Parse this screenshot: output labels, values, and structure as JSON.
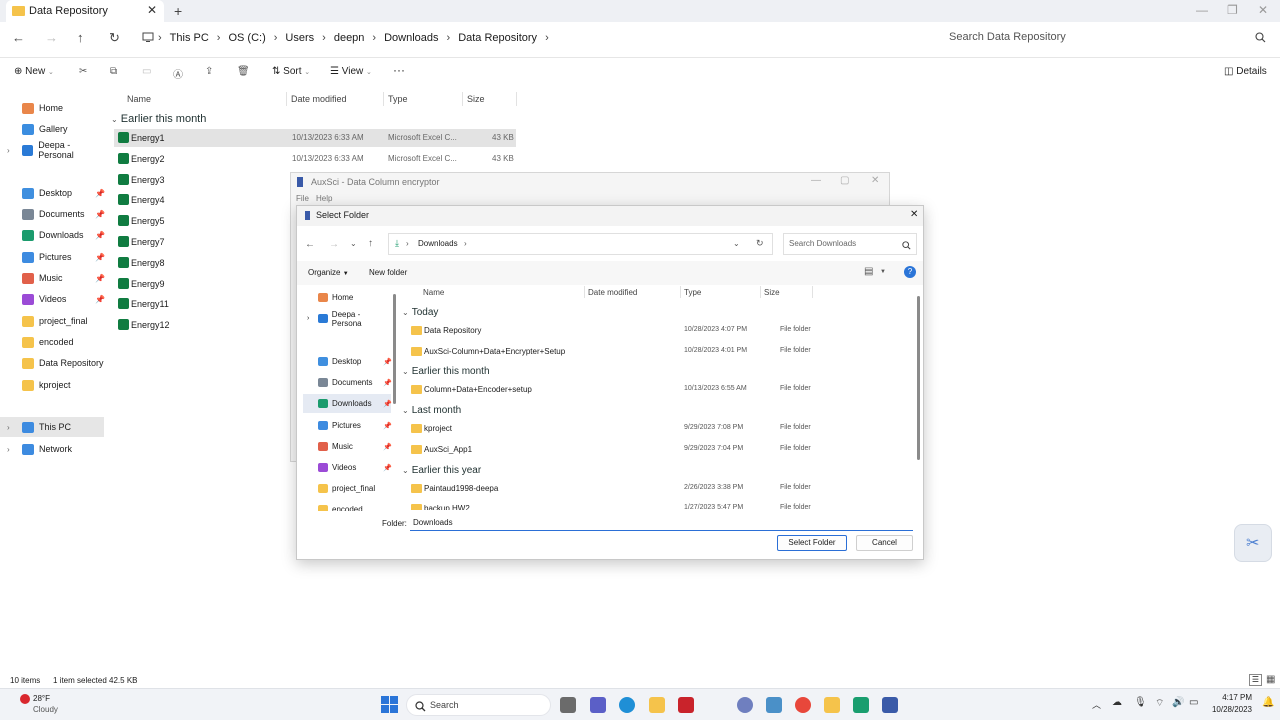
{
  "window": {
    "tab_title": "Data Repository",
    "new_tab": "+",
    "close_tab": "✕",
    "minimize": "—",
    "maximize": "❐",
    "close": "✕"
  },
  "address": {
    "crumbs": [
      "This PC",
      "OS (C:)",
      "Users",
      "deepn",
      "Downloads",
      "Data Repository"
    ],
    "search_placeholder": "Search Data Repository"
  },
  "toolbar": {
    "new": "New",
    "sort": "Sort",
    "view": "View",
    "more": "···",
    "details": "Details"
  },
  "sidebar": {
    "items": [
      {
        "label": "Home",
        "icon": "home-icon",
        "color": "#e9864a"
      },
      {
        "label": "Gallery",
        "icon": "gallery-icon",
        "color": "#3b8de0"
      },
      {
        "label": "Deepa - Personal",
        "icon": "onedrive-icon",
        "color": "#2a7ad6"
      },
      {
        "label": "Desktop",
        "icon": "desktop-icon",
        "color": "#3f8fdf"
      },
      {
        "label": "Documents",
        "icon": "documents-icon",
        "color": "#7a8796"
      },
      {
        "label": "Downloads",
        "icon": "downloads-icon",
        "color": "#1b9b6d"
      },
      {
        "label": "Pictures",
        "icon": "pictures-icon",
        "color": "#3d8be0"
      },
      {
        "label": "Music",
        "icon": "music-icon",
        "color": "#e1604a"
      },
      {
        "label": "Videos",
        "icon": "videos-icon",
        "color": "#9b4bd6"
      },
      {
        "label": "project_final",
        "icon": "folder-icon",
        "color": "#f5c34b"
      },
      {
        "label": "encoded",
        "icon": "folder-icon",
        "color": "#f5c34b"
      },
      {
        "label": "Data Repository",
        "icon": "folder-icon",
        "color": "#f5c34b"
      },
      {
        "label": "kproject",
        "icon": "folder-icon",
        "color": "#f5c34b"
      },
      {
        "label": "This PC",
        "icon": "pc-icon",
        "color": "#3d8be0"
      },
      {
        "label": "Network",
        "icon": "network-icon",
        "color": "#3d8be0"
      }
    ]
  },
  "list": {
    "columns": [
      "Name",
      "Date modified",
      "Type",
      "Size"
    ],
    "group": "Earlier this month",
    "files": [
      {
        "name": "Energy1",
        "date": "10/13/2023 6:33 AM",
        "type": "Microsoft Excel C...",
        "size": "43 KB"
      },
      {
        "name": "Energy2",
        "date": "10/13/2023 6:33 AM",
        "type": "Microsoft Excel C...",
        "size": "43 KB"
      },
      {
        "name": "Energy3",
        "date": "",
        "type": "",
        "size": ""
      },
      {
        "name": "Energy4",
        "date": "",
        "type": "",
        "size": ""
      },
      {
        "name": "Energy5",
        "date": "",
        "type": "",
        "size": ""
      },
      {
        "name": "Energy7",
        "date": "",
        "type": "",
        "size": ""
      },
      {
        "name": "Energy8",
        "date": "",
        "type": "",
        "size": ""
      },
      {
        "name": "Energy9",
        "date": "",
        "type": "",
        "size": ""
      },
      {
        "name": "Energy11",
        "date": "",
        "type": "",
        "size": ""
      },
      {
        "name": "Energy12",
        "date": "",
        "type": "",
        "size": ""
      }
    ]
  },
  "status": {
    "count": "10 items",
    "selection": "1 item selected  42.5 KB"
  },
  "auxsci": {
    "title": "AuxSci - Data Column encryptor",
    "menu_file": "File",
    "menu_help": "Help"
  },
  "dialog": {
    "title": "Select Folder",
    "path": "Downloads",
    "search_placeholder": "Search Downloads",
    "organize": "Organize",
    "new_folder": "New folder",
    "columns": [
      "Name",
      "Date modified",
      "Type",
      "Size"
    ],
    "groups": [
      {
        "label": "Today",
        "rows": [
          {
            "name": "Data Repository",
            "date": "10/28/2023 4:07 PM",
            "type": "File folder"
          },
          {
            "name": "AuxSci-Column+Data+Encrypter+Setup",
            "date": "10/28/2023 4:01 PM",
            "type": "File folder"
          }
        ]
      },
      {
        "label": "Earlier this month",
        "rows": [
          {
            "name": "Column+Data+Encoder+setup",
            "date": "10/13/2023 6:55 AM",
            "type": "File folder"
          }
        ]
      },
      {
        "label": "Last month",
        "rows": [
          {
            "name": "kproject",
            "date": "9/29/2023 7:08 PM",
            "type": "File folder"
          },
          {
            "name": "AuxSci_App1",
            "date": "9/29/2023 7:04 PM",
            "type": "File folder"
          }
        ]
      },
      {
        "label": "Earlier this year",
        "rows": [
          {
            "name": "Paintaud1998-deepa",
            "date": "2/26/2023 3:38 PM",
            "type": "File folder"
          },
          {
            "name": "backup HW2",
            "date": "1/27/2023 5:47 PM",
            "type": "File folder"
          }
        ]
      }
    ],
    "nav": [
      {
        "label": "Home",
        "color": "#e9864a"
      },
      {
        "label": "Deepa - Persona",
        "color": "#2a7ad6"
      },
      {
        "label": "Desktop",
        "color": "#3f8fdf"
      },
      {
        "label": "Documents",
        "color": "#7a8796"
      },
      {
        "label": "Downloads",
        "color": "#1b9b6d"
      },
      {
        "label": "Pictures",
        "color": "#3d8be0"
      },
      {
        "label": "Music",
        "color": "#e1604a"
      },
      {
        "label": "Videos",
        "color": "#9b4bd6"
      },
      {
        "label": "project_final",
        "color": "#f5c34b"
      },
      {
        "label": "encoded",
        "color": "#f5c34b"
      }
    ],
    "folder_label": "Folder:",
    "folder_value": "Downloads",
    "select_button": "Select Folder",
    "cancel_button": "Cancel"
  },
  "taskbar": {
    "weather_temp": "28°F",
    "weather_desc": "Cloudy",
    "search": "Search",
    "time": "4:17 PM",
    "date": "10/28/2023"
  }
}
